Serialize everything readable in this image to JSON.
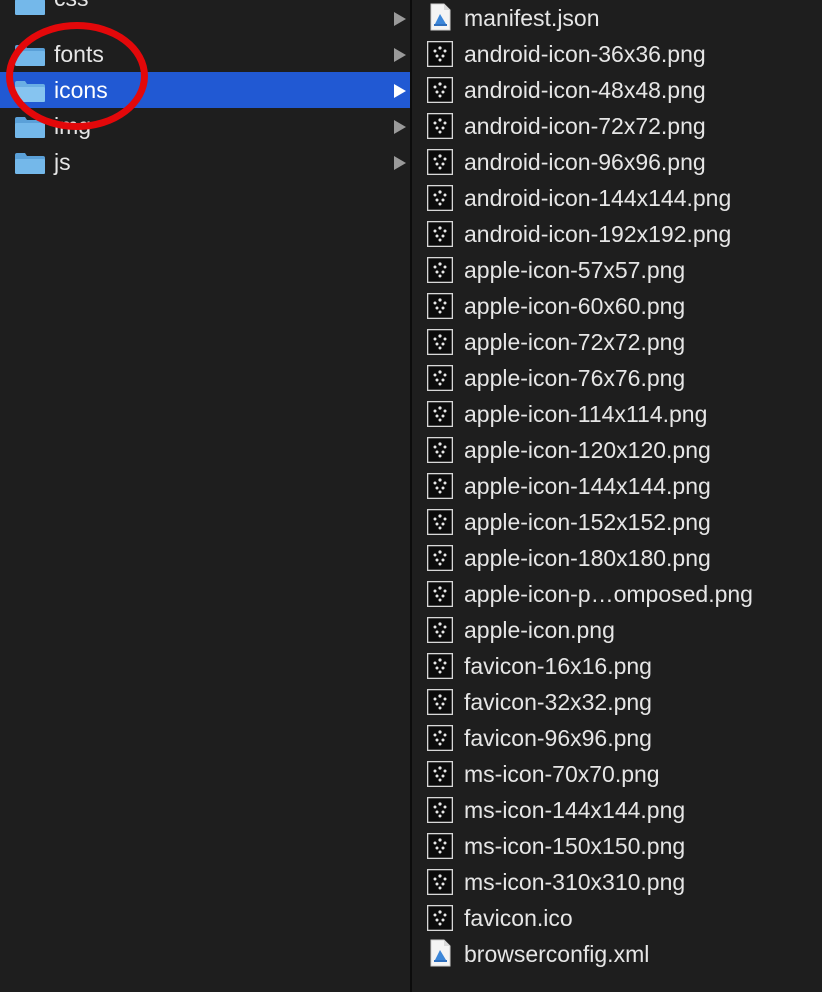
{
  "left_column": {
    "folders": [
      {
        "label": "css",
        "icon": "folder-icon",
        "selected": false
      },
      {
        "label": "fonts",
        "icon": "folder-icon",
        "selected": false
      },
      {
        "label": "icons",
        "icon": "folder-icon",
        "selected": true
      },
      {
        "label": "img",
        "icon": "folder-icon",
        "selected": false
      },
      {
        "label": "js",
        "icon": "folder-icon",
        "selected": false
      }
    ]
  },
  "right_column": {
    "files": [
      {
        "label": "manifest.json",
        "icon": "json-document-icon"
      },
      {
        "label": "android-icon-36x36.png",
        "icon": "image-thumbnail-icon"
      },
      {
        "label": "android-icon-48x48.png",
        "icon": "image-thumbnail-icon"
      },
      {
        "label": "android-icon-72x72.png",
        "icon": "image-thumbnail-icon"
      },
      {
        "label": "android-icon-96x96.png",
        "icon": "image-thumbnail-icon"
      },
      {
        "label": "android-icon-144x144.png",
        "icon": "image-thumbnail-icon"
      },
      {
        "label": "android-icon-192x192.png",
        "icon": "image-thumbnail-icon"
      },
      {
        "label": "apple-icon-57x57.png",
        "icon": "image-thumbnail-icon"
      },
      {
        "label": "apple-icon-60x60.png",
        "icon": "image-thumbnail-icon"
      },
      {
        "label": "apple-icon-72x72.png",
        "icon": "image-thumbnail-icon"
      },
      {
        "label": "apple-icon-76x76.png",
        "icon": "image-thumbnail-icon"
      },
      {
        "label": "apple-icon-114x114.png",
        "icon": "image-thumbnail-icon"
      },
      {
        "label": "apple-icon-120x120.png",
        "icon": "image-thumbnail-icon"
      },
      {
        "label": "apple-icon-144x144.png",
        "icon": "image-thumbnail-icon"
      },
      {
        "label": "apple-icon-152x152.png",
        "icon": "image-thumbnail-icon"
      },
      {
        "label": "apple-icon-180x180.png",
        "icon": "image-thumbnail-icon"
      },
      {
        "label": "apple-icon-p…omposed.png",
        "icon": "image-thumbnail-icon"
      },
      {
        "label": "apple-icon.png",
        "icon": "image-thumbnail-icon"
      },
      {
        "label": "favicon-16x16.png",
        "icon": "image-thumbnail-icon"
      },
      {
        "label": "favicon-32x32.png",
        "icon": "image-thumbnail-icon"
      },
      {
        "label": "favicon-96x96.png",
        "icon": "image-thumbnail-icon"
      },
      {
        "label": "ms-icon-70x70.png",
        "icon": "image-thumbnail-icon"
      },
      {
        "label": "ms-icon-144x144.png",
        "icon": "image-thumbnail-icon"
      },
      {
        "label": "ms-icon-150x150.png",
        "icon": "image-thumbnail-icon"
      },
      {
        "label": "ms-icon-310x310.png",
        "icon": "image-thumbnail-icon"
      },
      {
        "label": "favicon.ico",
        "icon": "image-thumbnail-icon"
      },
      {
        "label": "browserconfig.xml",
        "icon": "xml-document-icon"
      }
    ]
  },
  "colors": {
    "background": "#1e1e1e",
    "selection": "#2159d3",
    "text": "#e6e6e6",
    "annotation": "#e3080a",
    "folder": "#6fb3e8"
  }
}
